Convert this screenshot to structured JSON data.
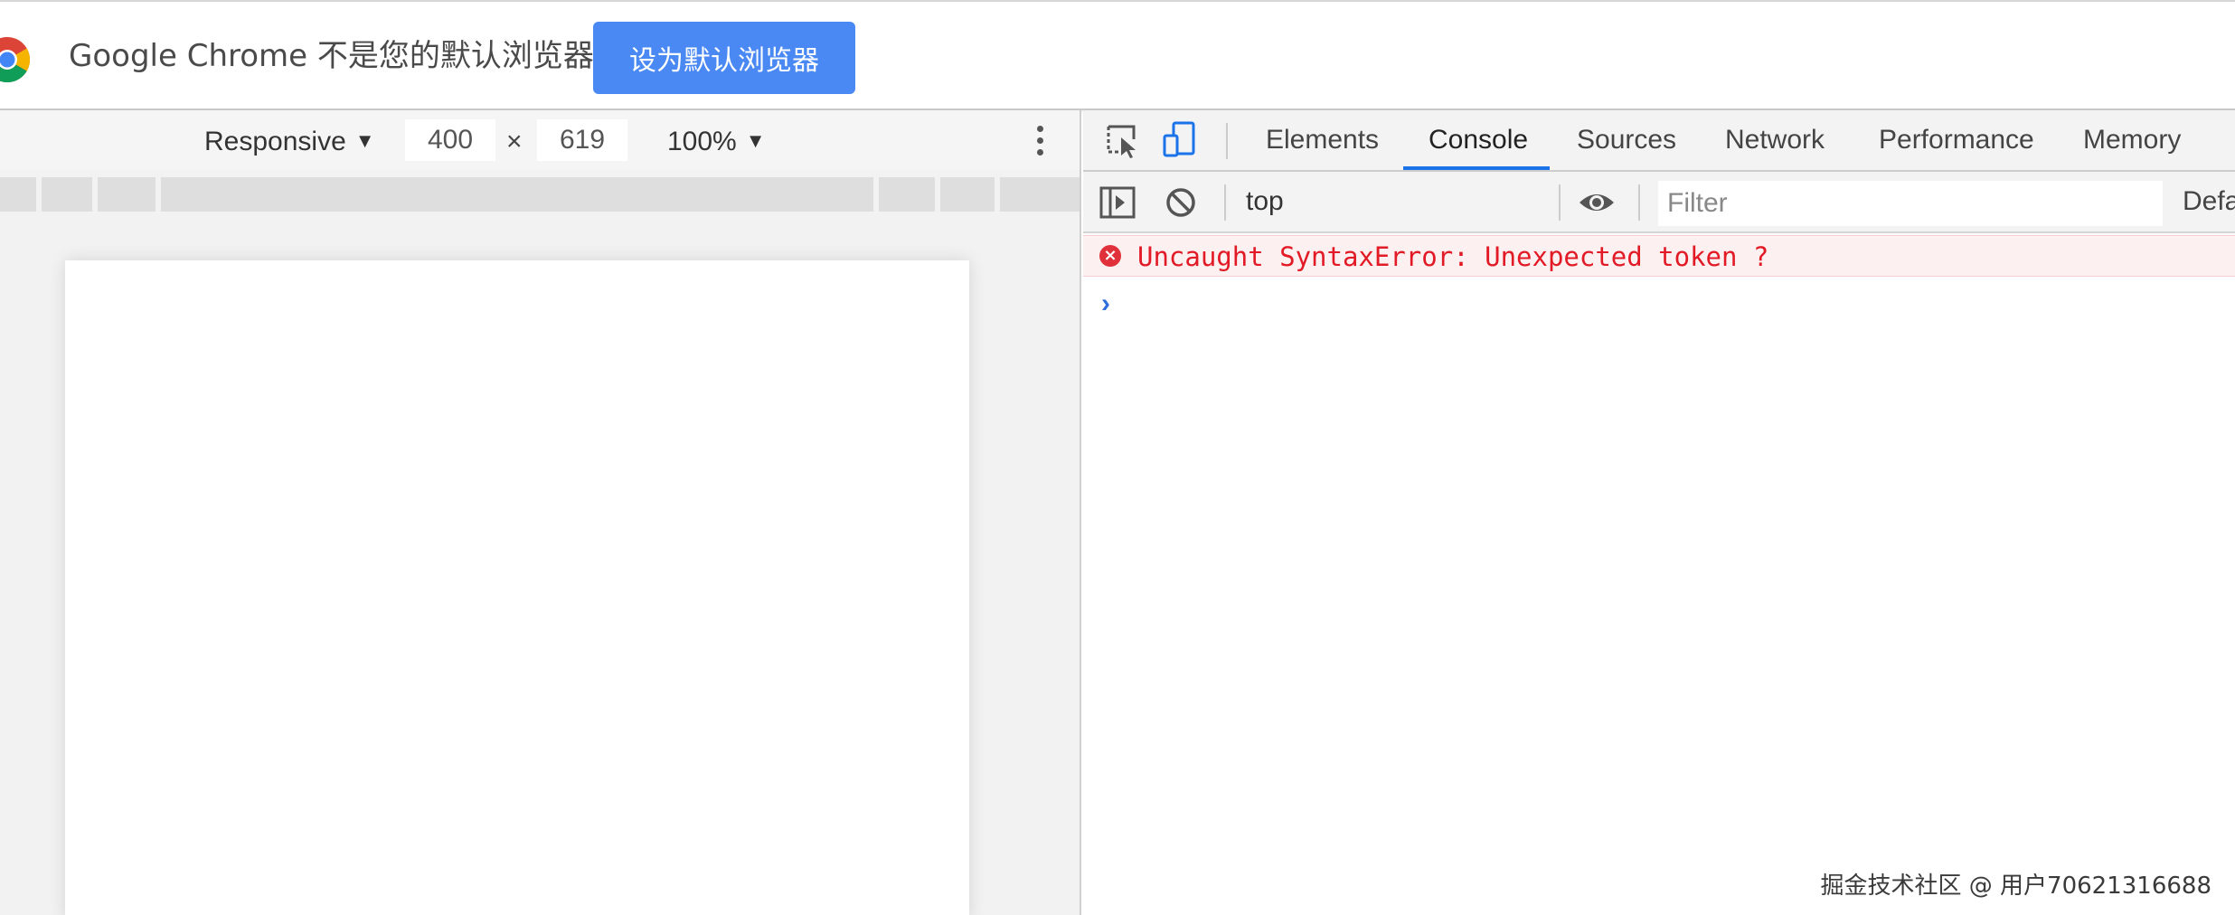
{
  "infobar": {
    "message": "Google Chrome 不是您的默认浏览器",
    "set_default_label": "设为默认浏览器"
  },
  "device_toolbar": {
    "device_mode": "Responsive",
    "width": "400",
    "times": "×",
    "height": "619",
    "zoom": "100%"
  },
  "devtools": {
    "tabs": [
      {
        "label": "Elements",
        "active": false
      },
      {
        "label": "Console",
        "active": true
      },
      {
        "label": "Sources",
        "active": false
      },
      {
        "label": "Network",
        "active": false
      },
      {
        "label": "Performance",
        "active": false
      },
      {
        "label": "Memory",
        "active": false
      }
    ],
    "console_toolbar": {
      "context": "top",
      "filter_placeholder": "Filter",
      "levels_label": "Defa"
    },
    "messages": [
      {
        "level": "error",
        "text": "Uncaught SyntaxError: Unexpected token ?"
      }
    ],
    "prompt": "›"
  },
  "watermark": "掘金技术社区 @ 用户70621316688",
  "colors": {
    "accent": "#1a73e8",
    "button_blue": "#4a89f3",
    "error_text": "#e21a26",
    "error_bg": "#fdf0f0"
  }
}
